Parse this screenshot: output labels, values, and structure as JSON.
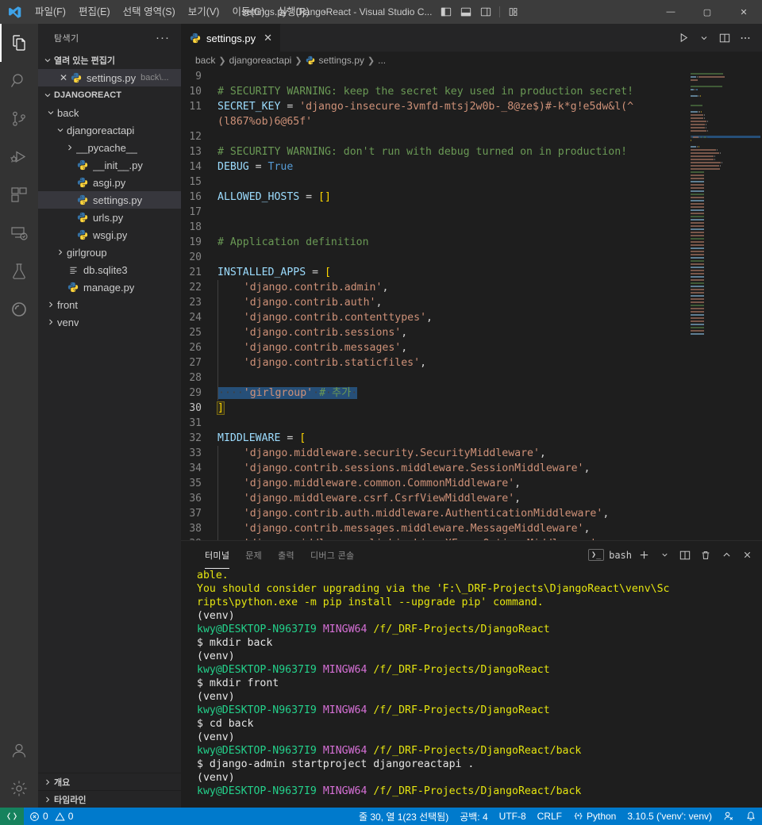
{
  "titlebar": {
    "menus": [
      "파일(F)",
      "편집(E)",
      "선택 영역(S)",
      "보기(V)",
      "이동(G)",
      "실행(R)",
      "···"
    ],
    "title": "settings.py - DjangoReact - Visual Studio C...",
    "layout_icons": [
      "toggle-primary-sidebar-icon",
      "toggle-panel-icon",
      "toggle-secondary-sidebar-icon",
      "customize-layout-icon"
    ],
    "window_controls": {
      "minimize": "—",
      "maximize": "▢",
      "close": "✕"
    }
  },
  "activitybar": {
    "items": [
      {
        "name": "explorer-icon",
        "label": "탐색기",
        "active": true
      },
      {
        "name": "search-icon",
        "label": "검색",
        "active": false
      },
      {
        "name": "source-control-icon",
        "label": "소스 제어",
        "active": false
      },
      {
        "name": "run-and-debug-icon",
        "label": "실행 및 디버그",
        "active": false
      },
      {
        "name": "extensions-icon",
        "label": "확장",
        "active": false
      },
      {
        "name": "remote-explorer-icon",
        "label": "원격 탐색기",
        "active": false
      },
      {
        "name": "testing-icon",
        "label": "테스트",
        "active": false
      },
      {
        "name": "python-env-icon",
        "label": "Python",
        "active": false
      }
    ],
    "bottom": [
      {
        "name": "accounts-icon",
        "label": "계정"
      },
      {
        "name": "settings-gear-icon",
        "label": "관리"
      }
    ]
  },
  "sidebar": {
    "title": "탐색기",
    "more_actions": "···",
    "open_editors": {
      "title": "열려 있는 편집기",
      "items": [
        {
          "close": "✕",
          "icon": "python-file-icon",
          "label": "settings.py",
          "desc": "back\\..."
        }
      ]
    },
    "workspace": {
      "title": "DJANGOREACT",
      "tree": [
        {
          "depth": 0,
          "type": "folder",
          "expanded": true,
          "label": "back"
        },
        {
          "depth": 1,
          "type": "folder",
          "expanded": true,
          "label": "djangoreactapi"
        },
        {
          "depth": 2,
          "type": "folder",
          "expanded": false,
          "label": "__pycache__"
        },
        {
          "depth": 2,
          "type": "py",
          "label": "__init__.py"
        },
        {
          "depth": 2,
          "type": "py",
          "label": "asgi.py"
        },
        {
          "depth": 2,
          "type": "py",
          "label": "settings.py",
          "selected": true
        },
        {
          "depth": 2,
          "type": "py",
          "label": "urls.py"
        },
        {
          "depth": 2,
          "type": "py",
          "label": "wsgi.py"
        },
        {
          "depth": 1,
          "type": "folder",
          "expanded": false,
          "label": "girlgroup"
        },
        {
          "depth": 1,
          "type": "db",
          "label": "db.sqlite3"
        },
        {
          "depth": 1,
          "type": "py",
          "label": "manage.py"
        },
        {
          "depth": 0,
          "type": "folder",
          "expanded": false,
          "label": "front"
        },
        {
          "depth": 0,
          "type": "folder",
          "expanded": false,
          "label": "venv"
        }
      ]
    },
    "bottom_sections": [
      "개요",
      "타임라인"
    ]
  },
  "editor": {
    "tab": {
      "label": "settings.py",
      "icon": "python-file-icon",
      "close": "✕"
    },
    "actions": [
      "run-python-file-icon",
      "chevron-down-icon",
      "split-editor-icon",
      "more-actions-icon"
    ],
    "breadcrumb": [
      "back",
      "djangoreactapi",
      "settings.py",
      "..."
    ],
    "lines": [
      {
        "n": "9",
        "segs": []
      },
      {
        "n": "10",
        "segs": [
          {
            "t": "# SECURITY WARNING: keep the secret key used in production secret!",
            "c": "tok-c"
          }
        ]
      },
      {
        "n": "11",
        "segs": [
          {
            "t": "SECRET_KEY ",
            "c": "tok-v"
          },
          {
            "t": "= ",
            "c": "tok-p"
          },
          {
            "t": "'django-insecure-3vmfd-mtsj2w0b-_8@ze$)#-k*g!e5dw&l(^",
            "c": "tok-s"
          }
        ]
      },
      {
        "n": "",
        "wrap": true,
        "segs": [
          {
            "t": "(l867%ob)6@65f'",
            "c": "tok-s"
          }
        ]
      },
      {
        "n": "12",
        "segs": []
      },
      {
        "n": "13",
        "segs": [
          {
            "t": "# SECURITY WARNING: don't run with debug turned on in production!",
            "c": "tok-c"
          }
        ]
      },
      {
        "n": "14",
        "segs": [
          {
            "t": "DEBUG ",
            "c": "tok-v"
          },
          {
            "t": "= ",
            "c": "tok-p"
          },
          {
            "t": "True",
            "c": "tok-k"
          }
        ]
      },
      {
        "n": "15",
        "segs": []
      },
      {
        "n": "16",
        "segs": [
          {
            "t": "ALLOWED_HOSTS ",
            "c": "tok-v"
          },
          {
            "t": "= ",
            "c": "tok-p"
          },
          {
            "t": "[]",
            "c": "tok-b"
          }
        ]
      },
      {
        "n": "17",
        "segs": []
      },
      {
        "n": "18",
        "segs": []
      },
      {
        "n": "19",
        "segs": [
          {
            "t": "# Application definition",
            "c": "tok-c"
          }
        ]
      },
      {
        "n": "20",
        "segs": []
      },
      {
        "n": "21",
        "segs": [
          {
            "t": "INSTALLED_APPS ",
            "c": "tok-v"
          },
          {
            "t": "= ",
            "c": "tok-p"
          },
          {
            "t": "[",
            "c": "tok-b"
          }
        ]
      },
      {
        "n": "22",
        "indent": 1,
        "segs": [
          {
            "t": "    'django.contrib.admin'",
            "c": "tok-s"
          },
          {
            "t": ",",
            "c": "tok-p"
          }
        ]
      },
      {
        "n": "23",
        "indent": 1,
        "segs": [
          {
            "t": "    'django.contrib.auth'",
            "c": "tok-s"
          },
          {
            "t": ",",
            "c": "tok-p"
          }
        ]
      },
      {
        "n": "24",
        "indent": 1,
        "segs": [
          {
            "t": "    'django.contrib.contenttypes'",
            "c": "tok-s"
          },
          {
            "t": ",",
            "c": "tok-p"
          }
        ]
      },
      {
        "n": "25",
        "indent": 1,
        "segs": [
          {
            "t": "    'django.contrib.sessions'",
            "c": "tok-s"
          },
          {
            "t": ",",
            "c": "tok-p"
          }
        ]
      },
      {
        "n": "26",
        "indent": 1,
        "segs": [
          {
            "t": "    'django.contrib.messages'",
            "c": "tok-s"
          },
          {
            "t": ",",
            "c": "tok-p"
          }
        ]
      },
      {
        "n": "27",
        "indent": 1,
        "segs": [
          {
            "t": "    'django.contrib.staticfiles'",
            "c": "tok-s"
          },
          {
            "t": ",",
            "c": "tok-p"
          }
        ]
      },
      {
        "n": "28",
        "indent": 1,
        "segs": []
      },
      {
        "n": "29",
        "indent": 1,
        "selected": true,
        "segs": [
          {
            "t": "····",
            "c": "ws"
          },
          {
            "t": "'girlgroup'",
            "c": "tok-s"
          },
          {
            "t": "·",
            "c": "ws"
          },
          {
            "t": "#",
            "c": "tok-c"
          },
          {
            "t": "·",
            "c": "ws"
          },
          {
            "t": "추가",
            "c": "tok-c"
          },
          {
            "t": "·",
            "c": "ws"
          }
        ]
      },
      {
        "n": "30",
        "cur": true,
        "segs": [
          {
            "t": "]",
            "c": "tok-b",
            "bracket": true
          }
        ]
      },
      {
        "n": "31",
        "segs": []
      },
      {
        "n": "32",
        "segs": [
          {
            "t": "MIDDLEWARE ",
            "c": "tok-v"
          },
          {
            "t": "= ",
            "c": "tok-p"
          },
          {
            "t": "[",
            "c": "tok-b"
          }
        ]
      },
      {
        "n": "33",
        "indent": 1,
        "segs": [
          {
            "t": "    'django.middleware.security.SecurityMiddleware'",
            "c": "tok-s"
          },
          {
            "t": ",",
            "c": "tok-p"
          }
        ]
      },
      {
        "n": "34",
        "indent": 1,
        "segs": [
          {
            "t": "    'django.contrib.sessions.middleware.SessionMiddleware'",
            "c": "tok-s"
          },
          {
            "t": ",",
            "c": "tok-p"
          }
        ]
      },
      {
        "n": "35",
        "indent": 1,
        "segs": [
          {
            "t": "    'django.middleware.common.CommonMiddleware'",
            "c": "tok-s"
          },
          {
            "t": ",",
            "c": "tok-p"
          }
        ]
      },
      {
        "n": "36",
        "indent": 1,
        "segs": [
          {
            "t": "    'django.middleware.csrf.CsrfViewMiddleware'",
            "c": "tok-s"
          },
          {
            "t": ",",
            "c": "tok-p"
          }
        ]
      },
      {
        "n": "37",
        "indent": 1,
        "segs": [
          {
            "t": "    'django.contrib.auth.middleware.AuthenticationMiddleware'",
            "c": "tok-s"
          },
          {
            "t": ",",
            "c": "tok-p"
          }
        ]
      },
      {
        "n": "38",
        "indent": 1,
        "segs": [
          {
            "t": "    'django.contrib.messages.middleware.MessageMiddleware'",
            "c": "tok-s"
          },
          {
            "t": ",",
            "c": "tok-p"
          }
        ]
      },
      {
        "n": "39",
        "indent": 1,
        "clip": true,
        "segs": [
          {
            "t": "    'django.middleware.clickjacking.XFrameOptionsMiddleware'",
            "c": "tok-s"
          }
        ]
      }
    ]
  },
  "panel": {
    "tabs": [
      {
        "label": "터미널",
        "active": true
      },
      {
        "label": "문제",
        "active": false
      },
      {
        "label": "출력",
        "active": false
      },
      {
        "label": "디버그 콘솔",
        "active": false
      }
    ],
    "shell": "bash",
    "actions": [
      "new-terminal-icon",
      "chevron-down-icon",
      "split-terminal-icon",
      "kill-terminal-icon",
      "maximize-panel-icon",
      "close-panel-icon"
    ],
    "terminal_lines": [
      [
        {
          "t": "able.",
          "c": "t-yellow"
        }
      ],
      [
        {
          "t": "You should consider upgrading via the 'F:\\_DRF-Projects\\DjangoReact\\venv\\Sc",
          "c": "t-yellow"
        }
      ],
      [
        {
          "t": "ripts\\python.exe -m pip install --upgrade pip' command.",
          "c": "t-yellow"
        }
      ],
      [
        {
          "t": "(venv)",
          "c": "t-white"
        }
      ],
      [
        {
          "t": "kwy@DESKTOP-N9637I9",
          "c": "t-green"
        },
        {
          "t": " ",
          "c": "t-white"
        },
        {
          "t": "MINGW64",
          "c": "t-purple"
        },
        {
          "t": " ",
          "c": "t-white"
        },
        {
          "t": "/f/_DRF-Projects/DjangoReact",
          "c": "t-yellow"
        }
      ],
      [
        {
          "t": "$ mkdir back",
          "c": "t-white"
        }
      ],
      [
        {
          "t": "(venv)",
          "c": "t-white"
        }
      ],
      [
        {
          "t": "kwy@DESKTOP-N9637I9",
          "c": "t-green"
        },
        {
          "t": " ",
          "c": "t-white"
        },
        {
          "t": "MINGW64",
          "c": "t-purple"
        },
        {
          "t": " ",
          "c": "t-white"
        },
        {
          "t": "/f/_DRF-Projects/DjangoReact",
          "c": "t-yellow"
        }
      ],
      [
        {
          "t": "$ mkdir front",
          "c": "t-white"
        }
      ],
      [
        {
          "t": "(venv)",
          "c": "t-white"
        }
      ],
      [
        {
          "t": "kwy@DESKTOP-N9637I9",
          "c": "t-green"
        },
        {
          "t": " ",
          "c": "t-white"
        },
        {
          "t": "MINGW64",
          "c": "t-purple"
        },
        {
          "t": " ",
          "c": "t-white"
        },
        {
          "t": "/f/_DRF-Projects/DjangoReact",
          "c": "t-yellow"
        }
      ],
      [
        {
          "t": "$ cd back",
          "c": "t-white"
        }
      ],
      [
        {
          "t": "(venv)",
          "c": "t-white"
        }
      ],
      [
        {
          "t": "kwy@DESKTOP-N9637I9",
          "c": "t-green"
        },
        {
          "t": " ",
          "c": "t-white"
        },
        {
          "t": "MINGW64",
          "c": "t-purple"
        },
        {
          "t": " ",
          "c": "t-white"
        },
        {
          "t": "/f/_DRF-Projects/DjangoReact/back",
          "c": "t-yellow"
        }
      ],
      [
        {
          "t": "$ django-admin startproject djangoreactapi .",
          "c": "t-white"
        }
      ],
      [
        {
          "t": "(venv)",
          "c": "t-white"
        }
      ],
      [
        {
          "t": "kwy@DESKTOP-N9637I9",
          "c": "t-green"
        },
        {
          "t": " ",
          "c": "t-white"
        },
        {
          "t": "MINGW64",
          "c": "t-purple"
        },
        {
          "t": " ",
          "c": "t-white"
        },
        {
          "t": "/f/_DRF-Projects/DjangoReact/back",
          "c": "t-yellow"
        }
      ]
    ]
  },
  "statusbar": {
    "remote_icon": "remote-window-icon",
    "errors": "0",
    "warnings": "0",
    "cursor": "줄 30, 열 1(23 선택됨)",
    "indent": "공백: 4",
    "encoding": "UTF-8",
    "eol": "CRLF",
    "language": "Python",
    "interpreter": "3.10.5 ('venv': venv)",
    "right_icons": [
      "live-share-icon",
      "notifications-bell-icon"
    ]
  },
  "colors": {
    "accent": "#007acc",
    "remote_green": "#16825d",
    "titlebar_bg": "#3c3c3c",
    "sidebar_bg": "#252526",
    "editor_bg": "#1e1e1e",
    "activitybar_bg": "#333333",
    "selection_blue": "#264f78",
    "string": "#ce9178",
    "comment": "#6a9955",
    "keyword": "#569cd6",
    "variable": "#9cdcfe",
    "bracket_yellow": "#ffd700"
  }
}
